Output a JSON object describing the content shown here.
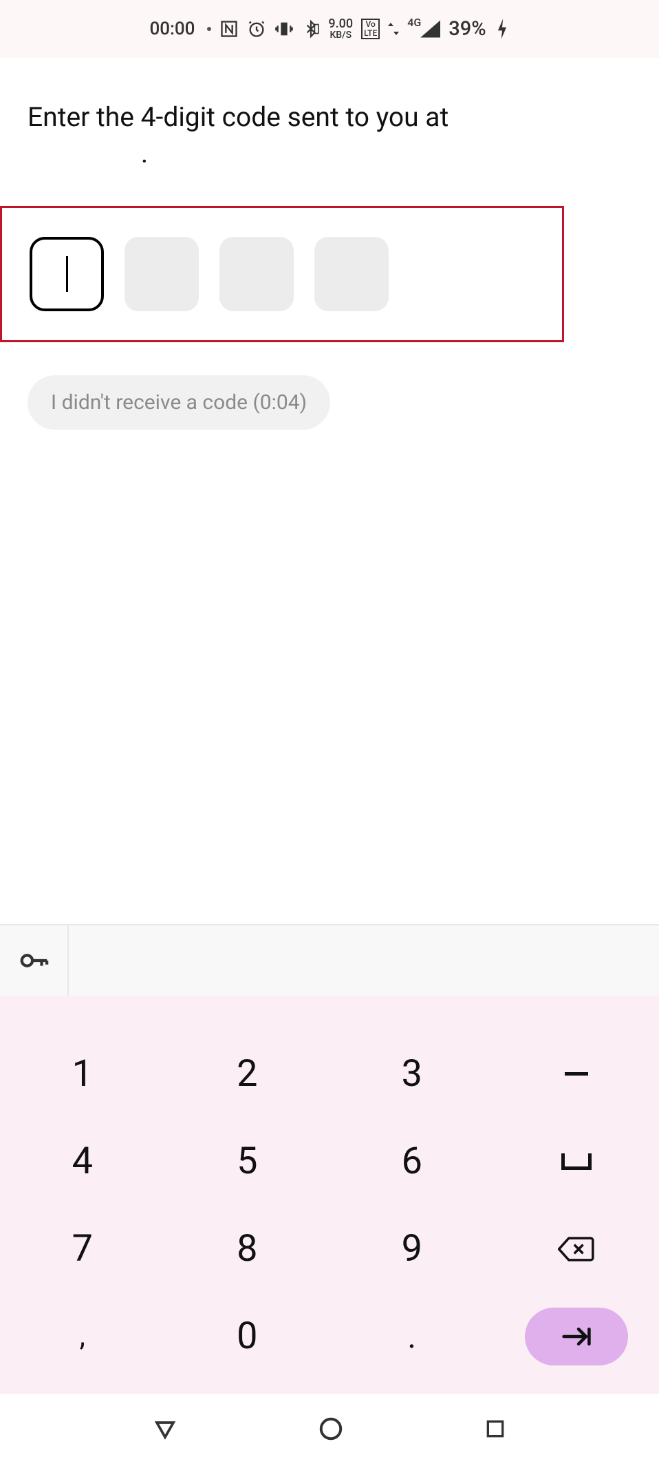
{
  "status": {
    "time": "00:00",
    "data_rate_top": "9.00",
    "data_rate_bot": "KB/S",
    "volte_top": "Vo",
    "volte_bot": "LTE",
    "network": "4G",
    "battery": "39%"
  },
  "heading": "Enter the 4-digit code sent to you at",
  "heading_suffix": ".",
  "code_digits": [
    "",
    "",
    "",
    ""
  ],
  "resend_chip": "I didn't receive a code (0:04)",
  "keypad": {
    "row1": [
      "1",
      "2",
      "3"
    ],
    "row2": [
      "4",
      "5",
      "6"
    ],
    "row3": [
      "7",
      "8",
      "9"
    ],
    "row4_comma": ",",
    "row4_zero": "0",
    "row4_dot": "."
  }
}
